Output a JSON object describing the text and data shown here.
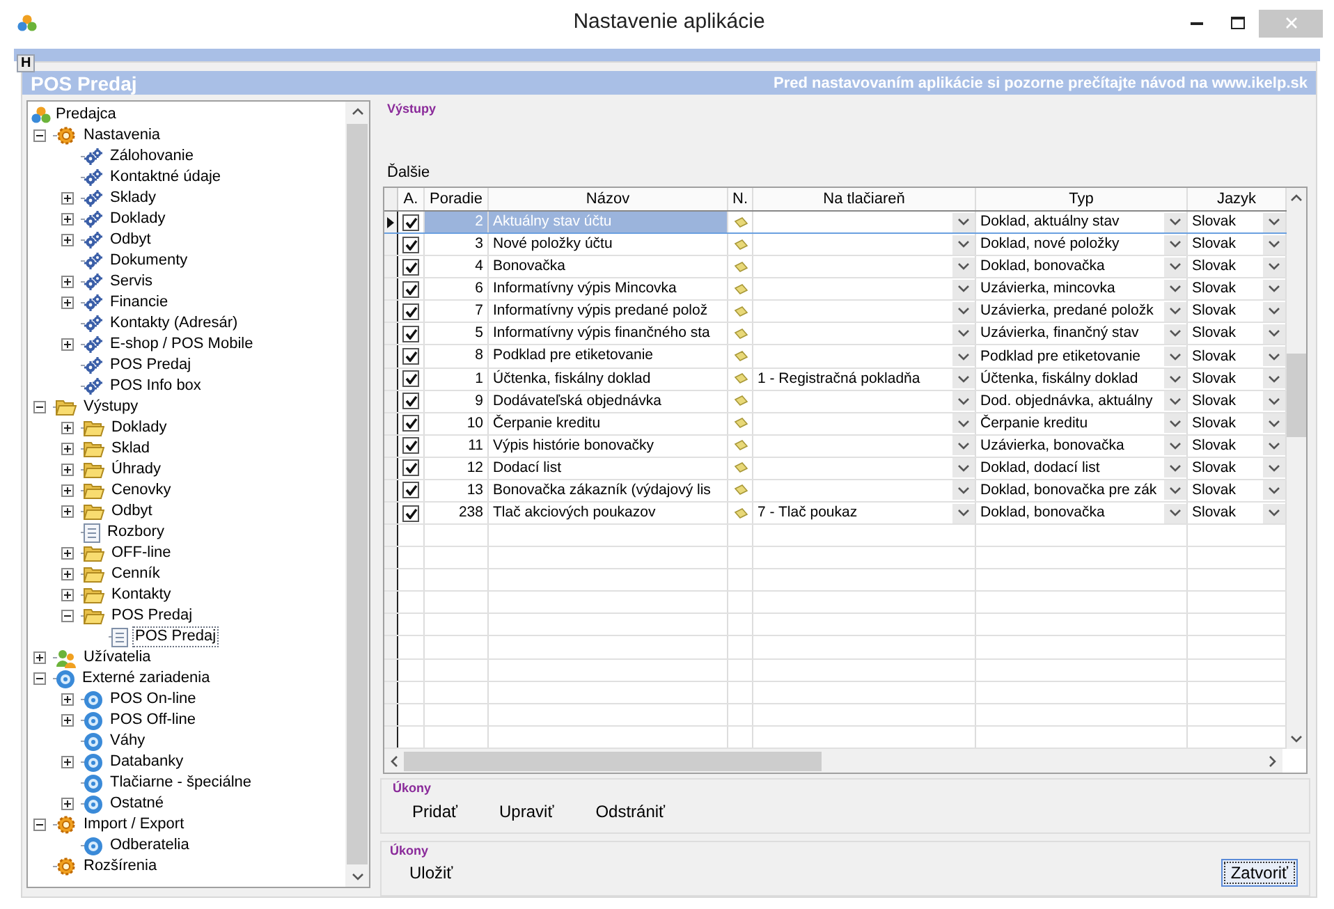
{
  "window": {
    "title": "Nastavenie aplikácie"
  },
  "help_tab": "H",
  "header": {
    "title": "POS Predaj",
    "notice": "Pred nastavovaním aplikácie si pozorne prečítajte návod na www.ikelp.sk"
  },
  "tree": {
    "root": "Predajca",
    "items": [
      {
        "label": "Nastavenia",
        "kind": "cog",
        "expanded": true,
        "children": [
          {
            "label": "Zálohovanie",
            "kind": "gear"
          },
          {
            "label": "Kontaktné údaje",
            "kind": "gear"
          },
          {
            "label": "Sklady",
            "kind": "gear",
            "expanded": false
          },
          {
            "label": "Doklady",
            "kind": "gear",
            "expanded": false
          },
          {
            "label": "Odbyt",
            "kind": "gear",
            "expanded": false
          },
          {
            "label": "Dokumenty",
            "kind": "gear"
          },
          {
            "label": "Servis",
            "kind": "gear",
            "expanded": false
          },
          {
            "label": "Financie",
            "kind": "gear",
            "expanded": false
          },
          {
            "label": "Kontakty (Adresár)",
            "kind": "gear"
          },
          {
            "label": "E-shop / POS Mobile",
            "kind": "gear",
            "expanded": false
          },
          {
            "label": "POS Predaj",
            "kind": "gear"
          },
          {
            "label": "POS Info box",
            "kind": "gear"
          }
        ]
      },
      {
        "label": "Výstupy",
        "kind": "folder",
        "expanded": true,
        "children": [
          {
            "label": "Doklady",
            "kind": "folder",
            "expanded": false
          },
          {
            "label": "Sklad",
            "kind": "folder",
            "expanded": false
          },
          {
            "label": "Úhrady",
            "kind": "folder",
            "expanded": false
          },
          {
            "label": "Cenovky",
            "kind": "folder",
            "expanded": false
          },
          {
            "label": "Odbyt",
            "kind": "folder",
            "expanded": false
          },
          {
            "label": "Rozbory",
            "kind": "document"
          },
          {
            "label": "OFF-line",
            "kind": "folder",
            "expanded": false
          },
          {
            "label": "Cenník",
            "kind": "folder",
            "expanded": false
          },
          {
            "label": "Kontakty",
            "kind": "folder",
            "expanded": false
          },
          {
            "label": "POS Predaj",
            "kind": "folder",
            "expanded": true,
            "children": [
              {
                "label": "POS Predaj",
                "kind": "document",
                "selected": true
              }
            ]
          }
        ]
      },
      {
        "label": "Užívatelia",
        "kind": "users",
        "expanded": false
      },
      {
        "label": "Externé zariadenia",
        "kind": "device",
        "expanded": true,
        "children": [
          {
            "label": "POS On-line",
            "kind": "device",
            "expanded": false
          },
          {
            "label": "POS Off-line",
            "kind": "device",
            "expanded": false
          },
          {
            "label": "Váhy",
            "kind": "device"
          },
          {
            "label": "Databanky",
            "kind": "device",
            "expanded": false
          },
          {
            "label": "Tlačiarne - špeciálne",
            "kind": "device"
          },
          {
            "label": "Ostatné",
            "kind": "device",
            "expanded": false
          }
        ]
      },
      {
        "label": "Import / Export",
        "kind": "cog",
        "expanded": true,
        "children": [
          {
            "label": "Odberatelia",
            "kind": "device"
          }
        ]
      },
      {
        "label": "Rozšírenia",
        "kind": "cog"
      }
    ]
  },
  "section_title": "Výstupy",
  "grid_title": "Ďalšie",
  "grid": {
    "columns": [
      "A.",
      "Poradie",
      "Názov",
      "N.",
      "Na tlačiareň",
      "Typ",
      "Jazyk"
    ],
    "rows": [
      {
        "active": true,
        "order": "2",
        "name": "Aktuálny stav účtu",
        "printer": "",
        "type": "Doklad, aktuálny stav",
        "language": "Slovak",
        "selected": true
      },
      {
        "active": true,
        "order": "3",
        "name": "Nové položky účtu",
        "printer": "",
        "type": "Doklad, nové položky",
        "language": "Slovak",
        "selected": false
      },
      {
        "active": true,
        "order": "4",
        "name": "Bonovačka",
        "printer": "",
        "type": "Doklad, bonovačka",
        "language": "Slovak",
        "selected": false
      },
      {
        "active": true,
        "order": "6",
        "name": "Informatívny výpis Mincovka",
        "printer": "",
        "type": "Uzávierka, mincovka",
        "language": "Slovak",
        "selected": false
      },
      {
        "active": true,
        "order": "7",
        "name": "Informatívny výpis predané polož",
        "printer": "",
        "type": "Uzávierka, predané položk",
        "language": "Slovak",
        "selected": false
      },
      {
        "active": true,
        "order": "5",
        "name": "Informatívny výpis finančného sta",
        "printer": "",
        "type": "Uzávierka, finančný stav",
        "language": "Slovak",
        "selected": false
      },
      {
        "active": true,
        "order": "8",
        "name": "Podklad pre etiketovanie",
        "printer": "",
        "type": "Podklad pre etiketovanie",
        "language": "Slovak",
        "selected": false
      },
      {
        "active": true,
        "order": "1",
        "name": "Účtenka, fiskálny doklad",
        "printer": "1 - Registračná pokladňa",
        "type": "Účtenka, fiskálny doklad",
        "language": "Slovak",
        "selected": false
      },
      {
        "active": true,
        "order": "9",
        "name": "Dodávateľská objednávka",
        "printer": "",
        "type": "Dod. objednávka, aktuálny",
        "language": "Slovak",
        "selected": false
      },
      {
        "active": true,
        "order": "10",
        "name": "Čerpanie kreditu",
        "printer": "",
        "type": "Čerpanie kreditu",
        "language": "Slovak",
        "selected": false
      },
      {
        "active": true,
        "order": "11",
        "name": "Výpis histórie bonovačky",
        "printer": "",
        "type": "Uzávierka, bonovačka",
        "language": "Slovak",
        "selected": false
      },
      {
        "active": true,
        "order": "12",
        "name": "Dodací list",
        "printer": "",
        "type": "Doklad, dodací list",
        "language": "Slovak",
        "selected": false
      },
      {
        "active": true,
        "order": "13",
        "name": "Bonovačka zákazník (výdajový lis",
        "printer": "",
        "type": "Doklad, bonovačka pre zák",
        "language": "Slovak",
        "selected": false
      },
      {
        "active": true,
        "order": "238",
        "name": "Tlač akciových poukazov",
        "printer": "7 - Tlač poukaz",
        "type": "Doklad, bonovačka",
        "language": "Slovak",
        "selected": false
      }
    ]
  },
  "actions": {
    "title": "Úkony",
    "buttons": [
      "Pridať",
      "Upraviť",
      "Odstrániť"
    ]
  },
  "footer": {
    "title": "Úkony",
    "save": "Uložiť",
    "close": "Zatvoriť"
  }
}
